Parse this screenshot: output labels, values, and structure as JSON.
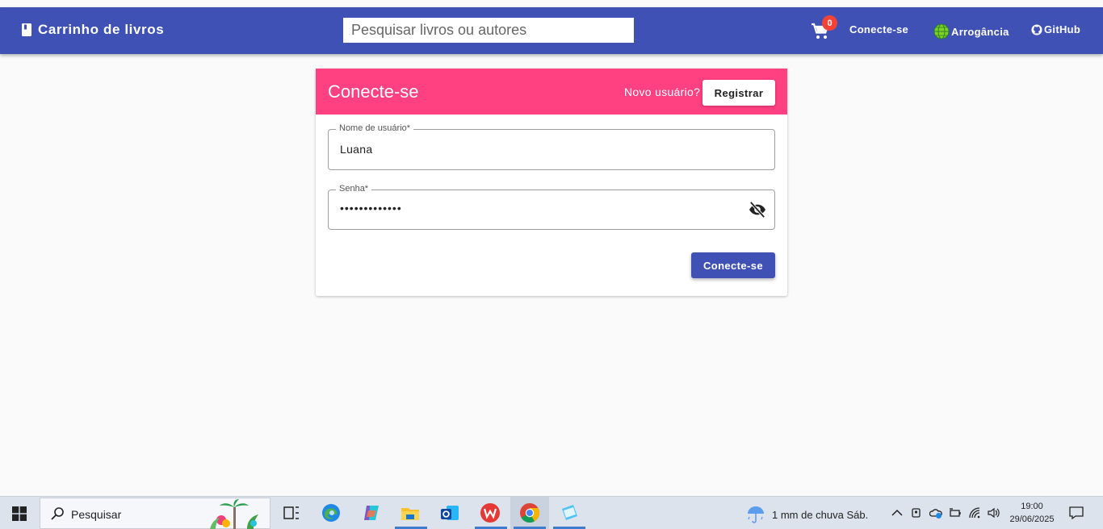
{
  "app": {
    "title": "Carrinho de livros",
    "search_placeholder": "Pesquisar livros ou autores",
    "cart_count": "0",
    "nav": {
      "login": "Conecte-se",
      "theme": "Arrogância",
      "github": "GitHub"
    }
  },
  "login_card": {
    "title": "Conecte-se",
    "new_user_text": "Novo usuário?",
    "register_label": "Registrar",
    "username_label": "Nome de usuário*",
    "username_value": "Luana",
    "password_label": "Senha*",
    "password_value": "•••••••••••••",
    "submit_label": "Conecte-se"
  },
  "taskbar": {
    "search_text": "Pesquisar",
    "weather": "1 mm de chuva Sáb.",
    "time": "19:00",
    "date": "29/06/2025"
  },
  "colors": {
    "primary": "#3f51b5",
    "accent": "#ff4081",
    "badge": "#f44336"
  }
}
